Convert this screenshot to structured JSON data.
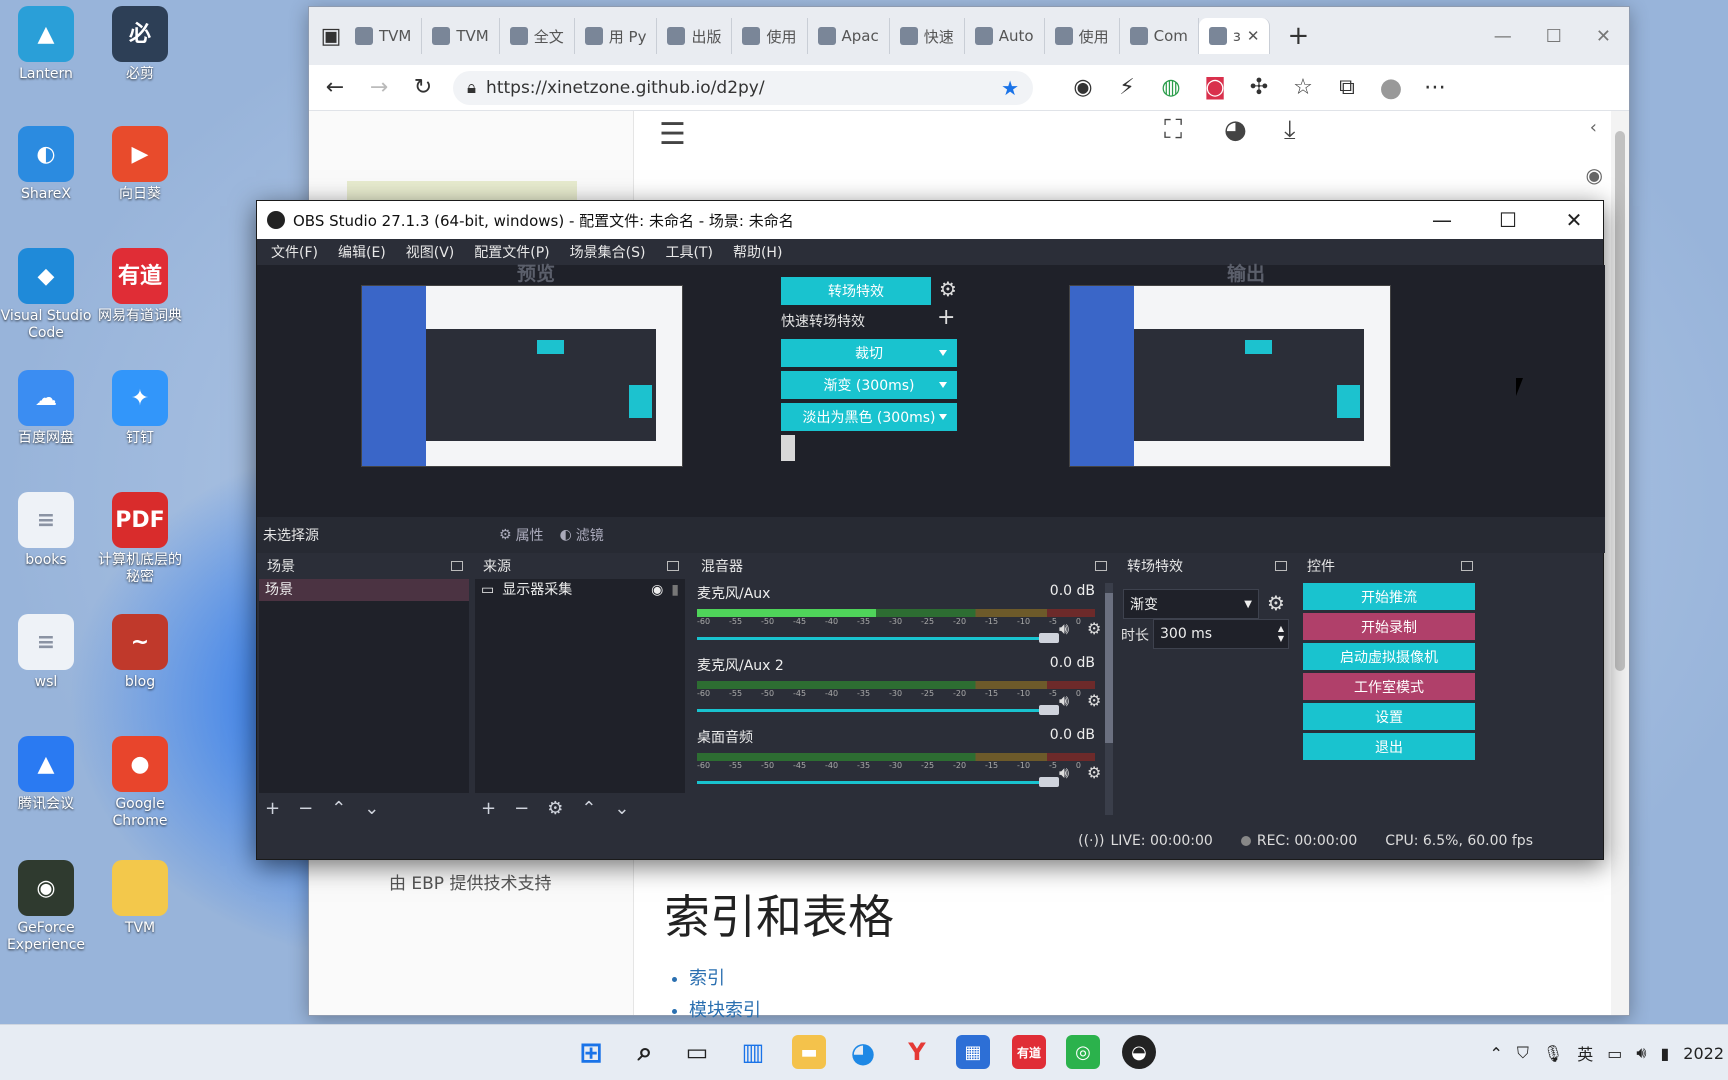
{
  "desktop": {
    "icons": [
      {
        "label": "Lantern",
        "glyph": "▲",
        "color": "#2a9fd8"
      },
      {
        "label": "必剪",
        "glyph": "必",
        "color": "#2d3f56"
      },
      {
        "label": "ShareX",
        "glyph": "◐",
        "color": "#2b8be0"
      },
      {
        "label": "向日葵",
        "glyph": "▶",
        "color": "#e84b2c"
      },
      {
        "label": "Visual Studio Code",
        "glyph": "◆",
        "color": "#1f8ad9"
      },
      {
        "label": "网易有道词典",
        "glyph": "有道",
        "color": "#e02d36"
      },
      {
        "label": "百度网盘",
        "glyph": "☁",
        "color": "#3b8df2"
      },
      {
        "label": "钉钉",
        "glyph": "✦",
        "color": "#3296fa"
      },
      {
        "label": "books",
        "glyph": "≡",
        "color": "#eef2f7"
      },
      {
        "label": "计算机底层的秘密",
        "glyph": "PDF",
        "color": "#d92c2c"
      },
      {
        "label": "wsl",
        "glyph": "≡",
        "color": "#eef2f7"
      },
      {
        "label": "blog",
        "glyph": "~",
        "color": "#c0392b"
      },
      {
        "label": "腾讯会议",
        "glyph": "▲",
        "color": "#2a7af2"
      },
      {
        "label": "Google Chrome",
        "glyph": "●",
        "color": "#e8452c"
      },
      {
        "label": "GeForce Experience",
        "glyph": "◉",
        "color": "#2f3a2f"
      },
      {
        "label": "TVM",
        "glyph": "",
        "color": "#f3c84b"
      }
    ]
  },
  "browser": {
    "tabs": [
      "TVM",
      "TVM",
      "全文",
      "用 Py",
      "出版",
      "使用",
      "Apac",
      "快速",
      "Auto",
      "使用",
      "Com",
      "ɜ"
    ],
    "url": "https://xinetzone.github.io/d2py/",
    "footer_powered": "由 EBP 提供技术支持",
    "heading": "索引和表格",
    "links": [
      "索引",
      "模块索引"
    ]
  },
  "obs": {
    "title": "OBS Studio 27.1.3 (64-bit, windows) - 配置文件: 未命名 - 场景: 未命名",
    "menu": [
      "文件(F)",
      "编辑(E)",
      "视图(V)",
      "配置文件(P)",
      "场景集合(S)",
      "工具(T)",
      "帮助(H)"
    ],
    "preview_label": "预览",
    "output_label": "输出",
    "transition_button": "转场特效",
    "quick_transitions_label": "快速转场特效",
    "quick_transitions": [
      "裁切",
      "渐变 (300ms)",
      "淡出为黑色 (300ms)"
    ],
    "no_source_selected": "未选择源",
    "properties_label": "属性",
    "filters_label": "滤镜",
    "docks": {
      "scenes_title": "场景",
      "scene_items": [
        "场景"
      ],
      "sources_title": "来源",
      "source_items": [
        "显示器采集"
      ],
      "mixer_title": "混音器",
      "mixer_channels": [
        {
          "name": "麦克风/Aux",
          "db": "0.0 dB",
          "level": 0.45
        },
        {
          "name": "麦克风/Aux 2",
          "db": "0.0 dB",
          "level": 0.0
        },
        {
          "name": "桌面音频",
          "db": "0.0 dB",
          "level": 0.0
        }
      ],
      "mixer_scale": [
        "-60",
        "-55",
        "-50",
        "-45",
        "-40",
        "-35",
        "-30",
        "-25",
        "-20",
        "-15",
        "-10",
        "-5",
        "0"
      ],
      "transitions_title": "转场特效",
      "transition_select": "渐变",
      "duration_label": "时长",
      "duration_value": "300 ms",
      "controls_title": "控件",
      "controls": [
        {
          "label": "开始推流",
          "color": "#19c3cf"
        },
        {
          "label": "开始录制",
          "color": "#b0406a"
        },
        {
          "label": "启动虚拟摄像机",
          "color": "#19c3cf"
        },
        {
          "label": "工作室模式",
          "color": "#b0406a"
        },
        {
          "label": "设置",
          "color": "#19c3cf"
        },
        {
          "label": "退出",
          "color": "#19c3cf"
        }
      ]
    },
    "status": {
      "live": "LIVE: 00:00:00",
      "rec": "REC: 00:00:00",
      "cpu": "CPU: 6.5%, 60.00 fps"
    }
  },
  "taskbar": {
    "ime": "英",
    "clock": "2022"
  }
}
